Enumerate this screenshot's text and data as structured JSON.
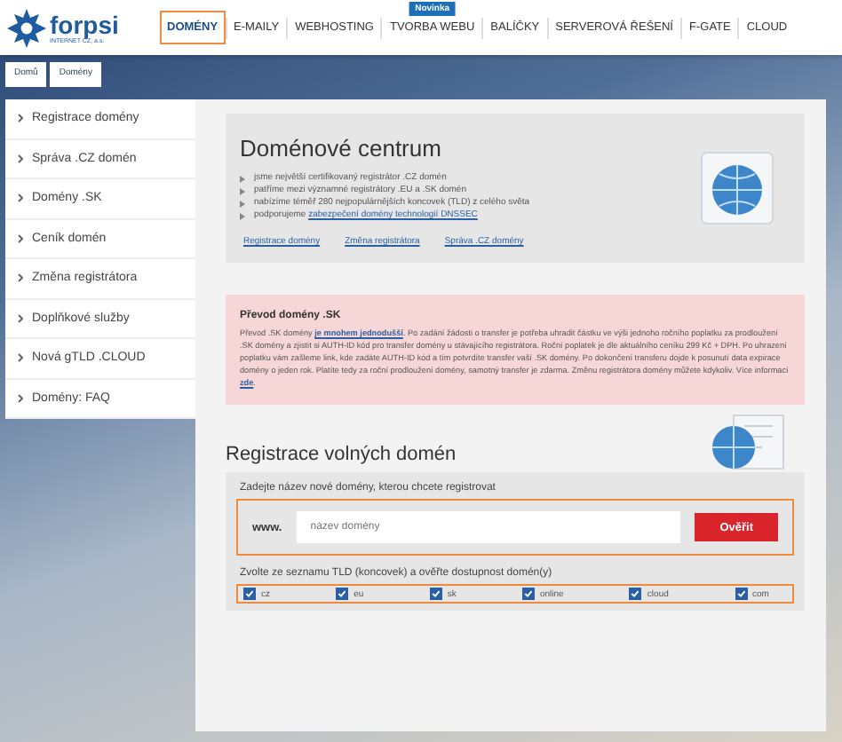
{
  "logo": {
    "name": "forpsi",
    "tagline": "INTERNET CZ, a.s."
  },
  "nav": [
    {
      "label": "DOMÉNY",
      "selected": true,
      "highlighted": true
    },
    {
      "label": "E-MAILY",
      "selected": false,
      "highlighted": false
    },
    {
      "label": "WEBHOSTING",
      "selected": false,
      "highlighted": false
    },
    {
      "label": "TVORBA WEBU",
      "selected": false,
      "highlighted": false,
      "badge": "Novinka"
    },
    {
      "label": "BALÍČKY",
      "selected": false,
      "highlighted": false
    },
    {
      "label": "SERVEROVÁ ŘEŠENÍ",
      "selected": false,
      "highlighted": false
    },
    {
      "label": "F-GATE",
      "selected": false,
      "highlighted": false
    },
    {
      "label": "CLOUD",
      "selected": false,
      "highlighted": false
    }
  ],
  "breadcrumb": [
    "Domů",
    "Domény"
  ],
  "sidebar": {
    "items": [
      {
        "label": "Registrace domény"
      },
      {
        "label": "Správa .CZ domén"
      },
      {
        "label": "Domény .SK"
      },
      {
        "label": "Ceník domén"
      },
      {
        "label": "Změna registrátora"
      },
      {
        "label": "Doplňkové služby"
      },
      {
        "label": "Nová gTLD .CLOUD"
      },
      {
        "label": "Domény: FAQ"
      }
    ]
  },
  "domain_center": {
    "title": "Doménové centrum",
    "bullets": [
      {
        "text": "jsme největší certifikovaný registrátor .CZ domén"
      },
      {
        "text": "patříme mezi významné registrátory .EU a .SK domén"
      },
      {
        "text": "nabízíme téměř 280 nejpopulárnějších koncovek (TLD) z celého světa"
      },
      {
        "text": "podporujeme ",
        "link": "zabezpečení domény technologií DNSSEC"
      }
    ],
    "links": [
      "Registrace domény",
      "Změna registrátora",
      "Správa .CZ domény"
    ]
  },
  "notice": {
    "title": "Převod domény .SK",
    "parts": [
      {
        "kind": "text",
        "text": "Převod .SK domény "
      },
      {
        "kind": "link",
        "text": "je mnohem jednodušší"
      },
      {
        "kind": "text",
        "text": ". Po zadání žádosti o transfer je potřeba uhradit částku ve výši jednoho ročního poplatku za prodloužení .SK domény a zjistit si AUTH-ID kód pro transfer domény u stávajícího registrátora. Roční poplatek je dle aktuálního ceníku 299 Kč + DPH. Po uhrazení poplatku vám zašleme link, kde zadáte AUTH-ID kód a tím potvrdíte transfer vaší .SK domény. Po dokončení transferu dojde k posunutí data expirace domény o jeden rok. Platíte tedy za roční prodloužení domény, samotný transfer je zdarma. Změnu registrátora domény můžete kdykoliv. Více informací "
      },
      {
        "kind": "link",
        "text": "zde"
      },
      {
        "kind": "text",
        "text": "."
      }
    ]
  },
  "registration": {
    "title": "Registrace volných domén",
    "prompt": "Zadejte název nové domény, kterou chcete registrovat",
    "prefix": "www.",
    "placeholder": "název domény",
    "button": "Ověřit",
    "input_highlighted": true,
    "tld_prompt": "Zvolte ze seznamu TLD (koncovek) a ověřte dostupnost domén(y)",
    "tlds_highlighted": true,
    "tlds": [
      {
        "label": "cz",
        "checked": true
      },
      {
        "label": "eu",
        "checked": true
      },
      {
        "label": "sk",
        "checked": true
      },
      {
        "label": "online",
        "checked": true
      },
      {
        "label": "cloud",
        "checked": true
      },
      {
        "label": "com",
        "checked": true
      }
    ]
  }
}
